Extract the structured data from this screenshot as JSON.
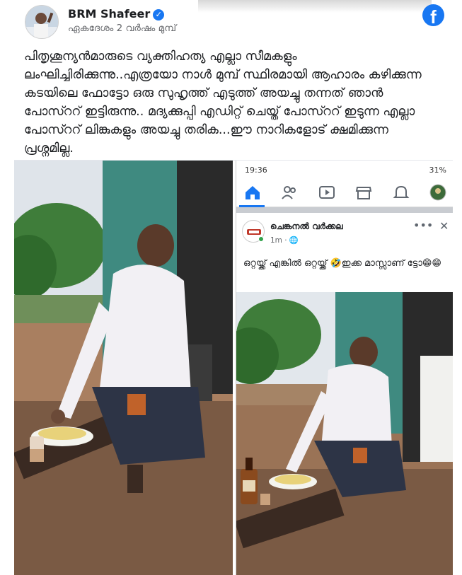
{
  "post": {
    "author": "BRM Shafeer",
    "timestamp": "ഏകദേശം 2 വർഷം മുമ്പ്",
    "text": "പിതൃശൂന്യൻമാരുടെ വ്യക്തിഹത്യ എല്ലാ സീമകളും ലംഘിച്ചിരിക്കുന്നു..എത്രയോ നാൾ മുമ്പ് സ്ഥിരമായി ആഹാരം കഴിക്കുന്ന കടയിലെ ഫോട്ടോ ഒരു സുഹൃത്ത് എടുത്ത് അയച്ചു തന്നത് ഞാൻ പോസ്ററ് ഇട്ടിരുന്നു.. മദ്യക്കുപ്പി എഡിറ്റ് ചെയ്ത് പോസ്ററ് ഇടുന്ന എല്ലാ പോസ്ററ് ലിങ്കുകളും അയച്ചു തരിക...ഈ നാറികളോട് ക്ഷമിക്കുന്ന പ്രശ്നമില്ല."
  },
  "screenshot": {
    "status_time": "19:36",
    "status_battery": "31%",
    "nav_icons": [
      "home-icon",
      "friends-icon",
      "watch-icon",
      "marketplace-icon",
      "bell-icon",
      "profile-icon"
    ],
    "page_name": "ചെങ്കനൽ വർക്കല",
    "page_meta": "1m · ",
    "shared_text": "ഒറ്റയ്ക്ക് എങ്കിൽ ഒറ്റയ്ക്ക് 🤣ഇക്ക മാസ്സാണ് ട്ടോ😁😁"
  },
  "colors": {
    "brand": "#1877f2",
    "text": "#1c1e21",
    "muted": "#65676b"
  }
}
